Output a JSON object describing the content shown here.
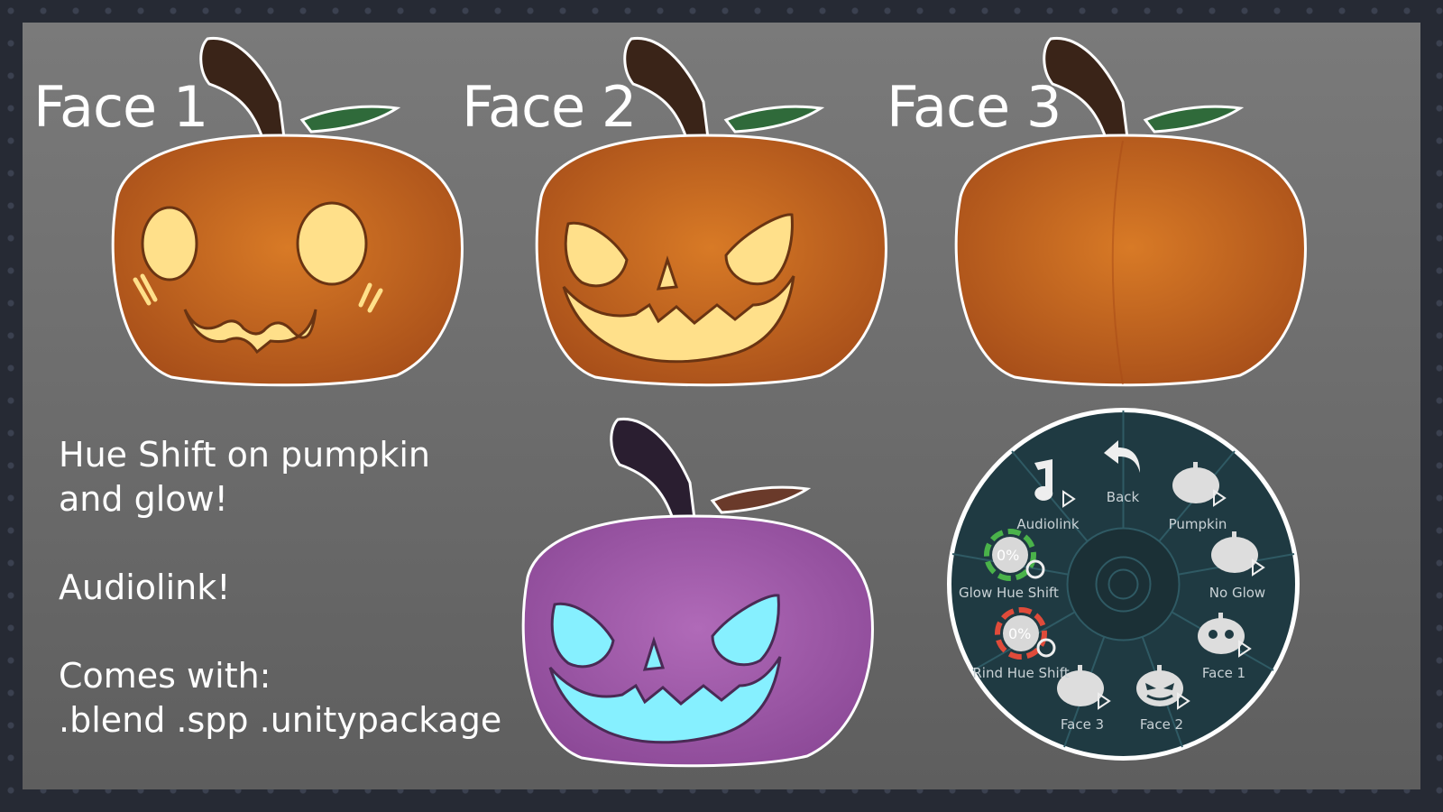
{
  "faces": [
    {
      "title": "Face 1"
    },
    {
      "title": "Face 2"
    },
    {
      "title": "Face 3"
    }
  ],
  "features": {
    "hue_shift": "Hue Shift on pumpkin",
    "hue_shift_2": "and glow!",
    "audiolink": "Audiolink!",
    "comes_with": "Comes with:",
    "files": ".blend .spp .unitypackage"
  },
  "radial_menu": {
    "items": [
      {
        "label": "Back",
        "icon": "back-arrow-icon"
      },
      {
        "label": "Pumpkin",
        "icon": "pumpkin-icon"
      },
      {
        "label": "No Glow",
        "icon": "pumpkin-icon"
      },
      {
        "label": "Face 1",
        "icon": "pumpkin-face-icon"
      },
      {
        "label": "Face 2",
        "icon": "pumpkin-face-icon"
      },
      {
        "label": "Face 3",
        "icon": "pumpkin-icon"
      },
      {
        "label": "Rind Hue Shift",
        "icon": "hue-wheel-icon",
        "value": "0%"
      },
      {
        "label": "Glow Hue Shift",
        "icon": "hue-wheel-icon",
        "value": "0%"
      },
      {
        "label": "Audiolink",
        "icon": "music-note-icon"
      }
    ]
  },
  "colors": {
    "pumpkin_orange": "#c8681c",
    "glow_yellow": "#ffe08a",
    "pumpkin_purple": "#a85fb0",
    "glow_cyan": "#86f0ff",
    "menu_bg": "#1f3a42"
  }
}
